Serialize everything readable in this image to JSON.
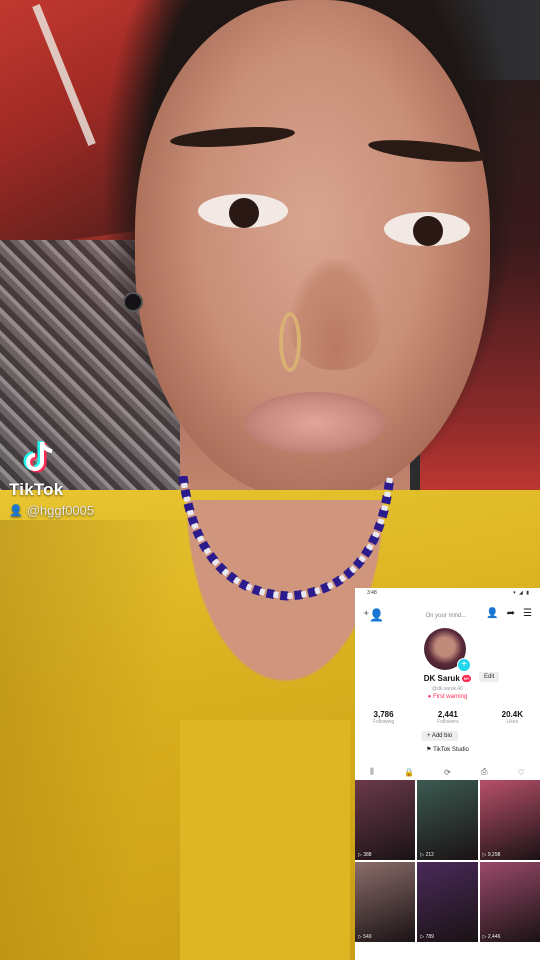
{
  "watermark": {
    "brand": "TikTok",
    "handle": "@hggf0005",
    "logo_icon": "tiktok-logo-icon",
    "user_icon": "user-icon"
  },
  "profile_screenshot": {
    "status_time": "3:48",
    "status_icons": "▾ ◢ ▮",
    "prompt": "On your mind...",
    "name": "DK Saruk",
    "badge": "N+",
    "edit_label": "Edit",
    "handle": "@dk.saruk.40",
    "warning": "First warning",
    "stats": [
      {
        "value": "3,786",
        "label": "Following"
      },
      {
        "value": "2,441",
        "label": "Followers"
      },
      {
        "value": "20.4K",
        "label": "Likes"
      }
    ],
    "add_bio": "+ Add bio",
    "studio": "TikTok Studio",
    "tabs": [
      {
        "icon": "grid-icon",
        "glyph": "⫼"
      },
      {
        "icon": "lock-icon",
        "glyph": "🔒"
      },
      {
        "icon": "repost-icon",
        "glyph": "⟳"
      },
      {
        "icon": "saved-icon",
        "glyph": "⎙"
      },
      {
        "icon": "liked-icon",
        "glyph": "♡"
      }
    ],
    "videos": [
      {
        "views": "▷ 388",
        "color": "#6b3a4a"
      },
      {
        "views": "▷ 212",
        "color": "#3c5a52"
      },
      {
        "views": "▷ 9,298",
        "color": "#b8506a"
      },
      {
        "views": "▷ 549",
        "color": "#8a6d6a"
      },
      {
        "views": "▷ 789",
        "color": "#4a2a5a"
      },
      {
        "views": "▷ 2,446",
        "color": "#9a4a6a"
      }
    ]
  }
}
